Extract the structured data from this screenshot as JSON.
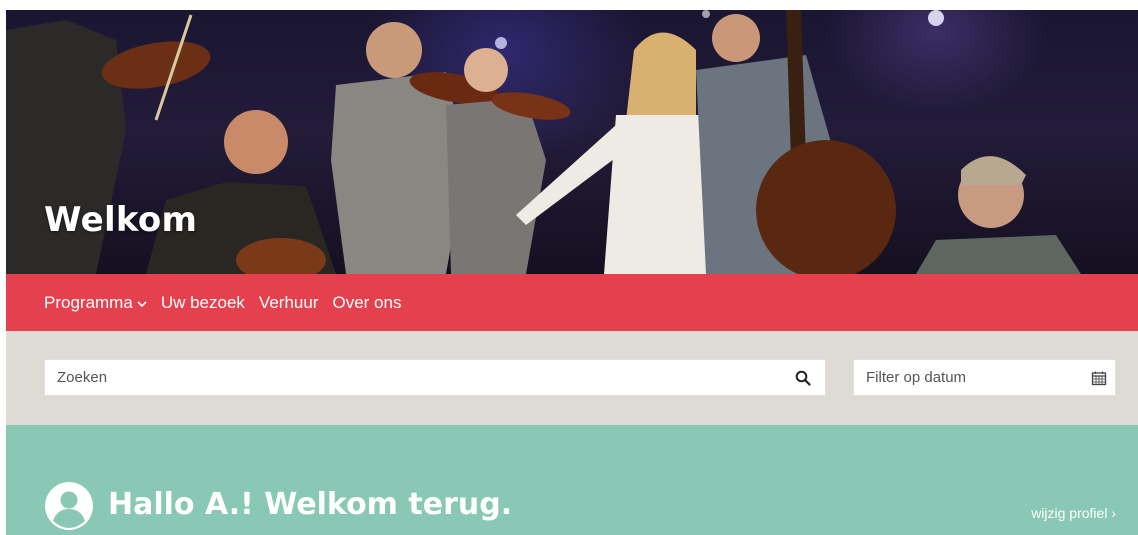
{
  "hero": {
    "title": "Welkom"
  },
  "nav": {
    "items": [
      {
        "label": "Programma",
        "has_dropdown": true
      },
      {
        "label": "Uw bezoek"
      },
      {
        "label": "Verhuur"
      },
      {
        "label": "Over ons"
      }
    ]
  },
  "search": {
    "placeholder": "Zoeken",
    "icon": "search-icon"
  },
  "date_filter": {
    "placeholder": "Filter op datum",
    "icon": "calendar-icon"
  },
  "welcome": {
    "greeting": "Hallo A.! Welkom terug.",
    "profile_link": "wijzig profiel ›",
    "avatar_icon": "user-avatar-icon"
  },
  "colors": {
    "nav_bg": "#e5404e",
    "search_bg": "#dedbd4",
    "welcome_bg": "#88c8b4"
  }
}
